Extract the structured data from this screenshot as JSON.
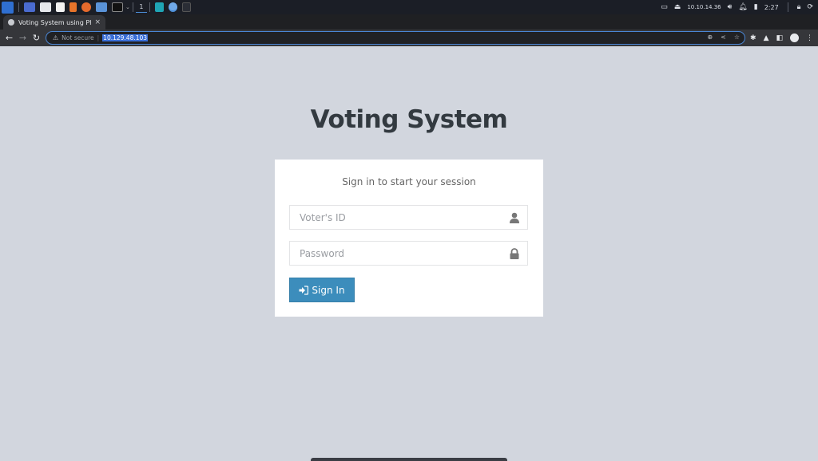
{
  "taskbar": {
    "workspace_number": "1",
    "ip_address": "10.10.14.36",
    "clock": "2:27"
  },
  "browser": {
    "tab_title": "Voting System using PHP",
    "tab_close": "×",
    "new_tab": "+",
    "security_label": "Not secure",
    "url": "10.129.48.103"
  },
  "page": {
    "title": "Voting System",
    "box_message": "Sign in to start your session",
    "voter_id_placeholder": "Voter's ID",
    "voter_id_value": "",
    "password_placeholder": "Password",
    "password_value": "",
    "signin_label": "Sign In"
  },
  "colors": {
    "page_bg": "#d2d6de",
    "button_primary": "#3c8dbc",
    "title_text": "#333a40",
    "url_highlight": "#3a6fd8"
  }
}
